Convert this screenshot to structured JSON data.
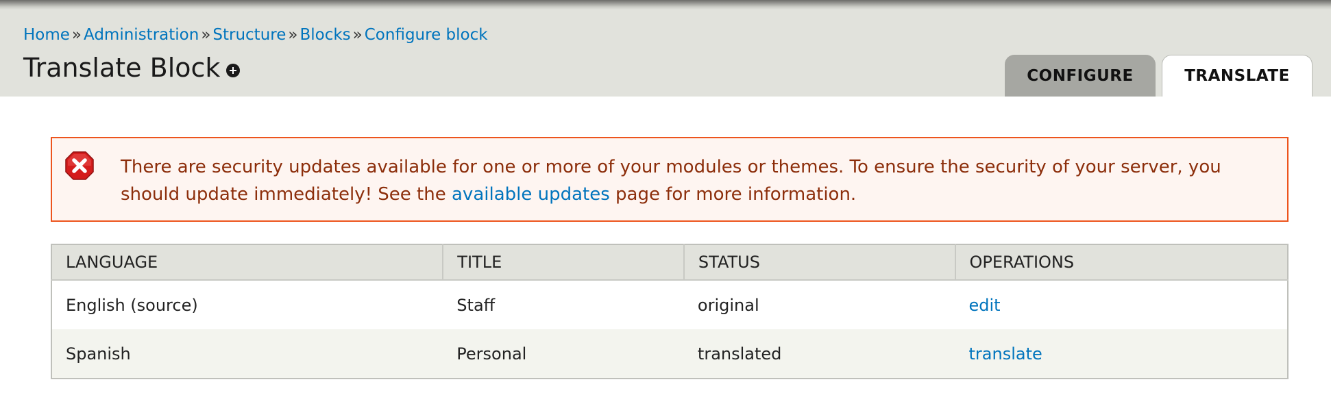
{
  "breadcrumb": {
    "items": [
      "Home",
      "Administration",
      "Structure",
      "Blocks",
      "Configure block"
    ],
    "separator": "»"
  },
  "page": {
    "title": "Translate Block"
  },
  "tabs": [
    {
      "label": "CONFIGURE",
      "active": false
    },
    {
      "label": "TRANSLATE",
      "active": true
    }
  ],
  "message": {
    "type": "error",
    "icon": "error-x-icon",
    "text_before": "There are security updates available for one or more of your modules or themes. To ensure the security of your server, you should update immediately! See the ",
    "link_text": "available updates",
    "text_after": " page for more information."
  },
  "table": {
    "headers": [
      "LANGUAGE",
      "TITLE",
      "STATUS",
      "OPERATIONS"
    ],
    "rows": [
      {
        "language": "English (source)",
        "title": "Staff",
        "status": "original",
        "operation": "edit"
      },
      {
        "language": "Spanish",
        "title": "Personal",
        "status": "translated",
        "operation": "translate"
      }
    ]
  },
  "colors": {
    "link": "#0074bd",
    "header_bg": "#e1e2dc",
    "error_border": "#ed541d",
    "error_bg": "#fef5f1",
    "error_text": "#8c2e0b"
  }
}
